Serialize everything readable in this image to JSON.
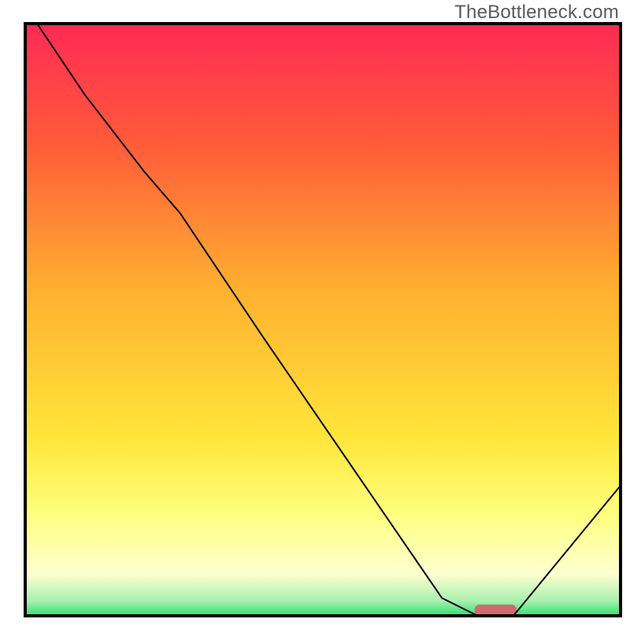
{
  "watermark": "TheBottleneck.com",
  "chart_data": {
    "type": "line",
    "title": "",
    "xlabel": "",
    "ylabel": "",
    "xlim": [
      0,
      100
    ],
    "ylim": [
      0,
      100
    ],
    "gradient_stops": [
      {
        "offset": 0.0,
        "color": "#ff2a55"
      },
      {
        "offset": 0.2,
        "color": "#ff5a3a"
      },
      {
        "offset": 0.45,
        "color": "#ffb030"
      },
      {
        "offset": 0.7,
        "color": "#ffe63a"
      },
      {
        "offset": 0.83,
        "color": "#ffff80"
      },
      {
        "offset": 0.93,
        "color": "#fdffd0"
      },
      {
        "offset": 0.975,
        "color": "#a8f0b0"
      },
      {
        "offset": 1.0,
        "color": "#2be06e"
      }
    ],
    "series": [
      {
        "name": "bottleneck-curve",
        "x": [
          2,
          10,
          20,
          26,
          40,
          55,
          70,
          76,
          82,
          100
        ],
        "y": [
          100,
          88,
          75,
          68,
          47,
          25,
          3,
          0,
          0,
          22
        ],
        "stroke": "#000000",
        "stroke_width": 2
      }
    ],
    "marker": {
      "name": "optimal-range-marker",
      "x_center": 79,
      "y": 0.8,
      "width": 7,
      "height": 2.2,
      "fill": "#d06a6e"
    },
    "frame": {
      "stroke": "#000000",
      "stroke_width": 4
    }
  }
}
